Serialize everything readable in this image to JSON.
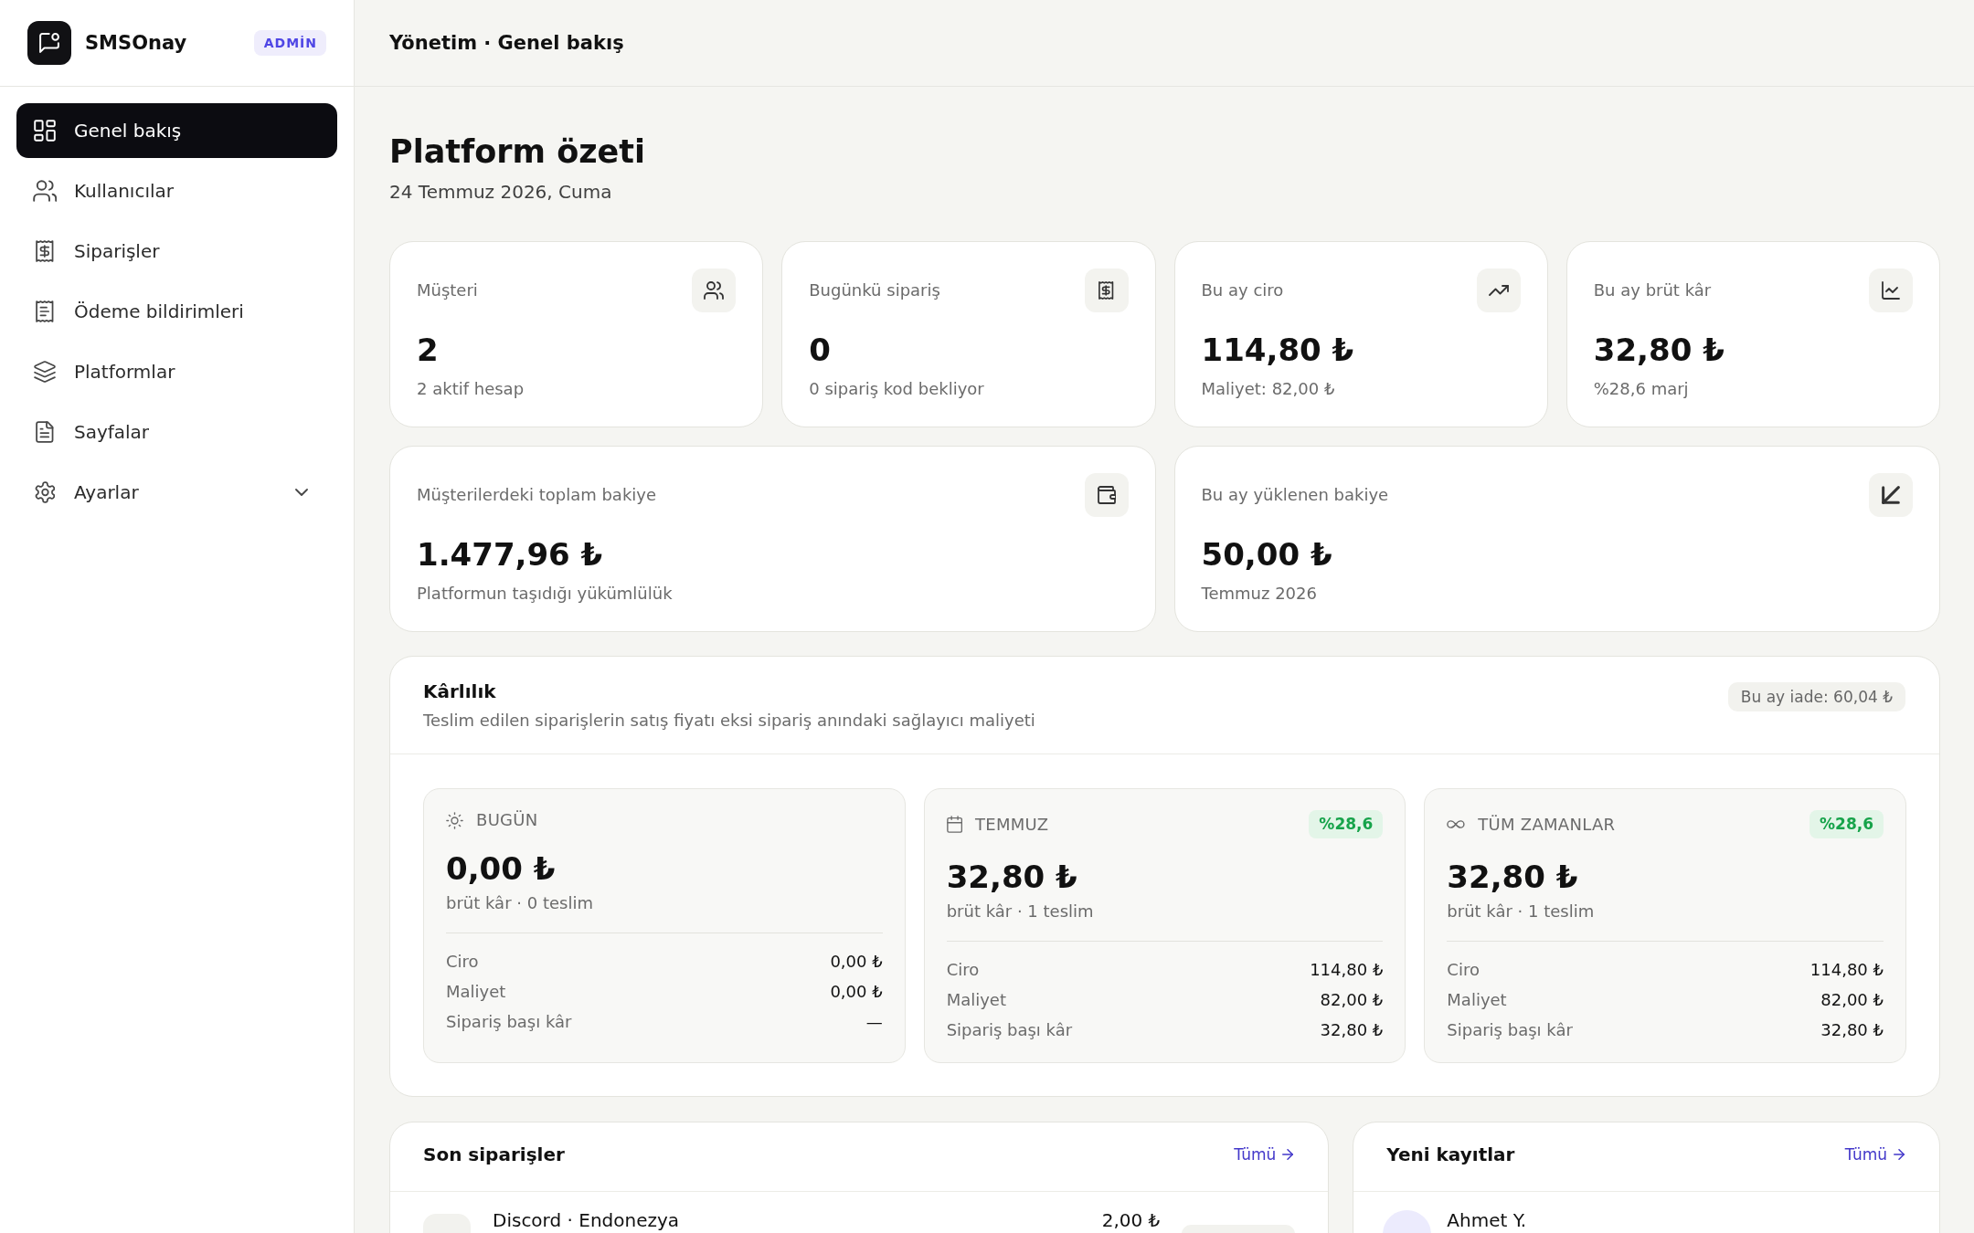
{
  "sidebar": {
    "brand": "SMSOnay",
    "role_badge": "ADMİN",
    "items": [
      {
        "label": "Genel bakış",
        "kind": "link",
        "selected": true
      },
      {
        "label": "Kullanıcılar",
        "kind": "link",
        "selected": false
      },
      {
        "label": "Siparişler",
        "kind": "link",
        "selected": false
      },
      {
        "label": "Ödeme bildirimleri",
        "kind": "link",
        "selected": false
      },
      {
        "label": "Platformlar",
        "kind": "link",
        "selected": false
      },
      {
        "label": "Sayfalar",
        "kind": "link",
        "selected": false
      },
      {
        "label": "Ayarlar",
        "kind": "group",
        "selected": false,
        "expanded": false
      }
    ]
  },
  "header": {
    "breadcrumb": "Yönetim · Genel bakış"
  },
  "page": {
    "title": "Platform özeti",
    "date": "24 Temmuz 2026, Cuma"
  },
  "stats": [
    {
      "label": "Müşteri",
      "value": "2",
      "note": "2 aktif hesap"
    },
    {
      "label": "Bugünkü sipariş",
      "value": "0",
      "note": "0 sipariş kod bekliyor"
    },
    {
      "label": "Bu ay ciro",
      "value": "114,80 ₺",
      "note": "Maliyet: 82,00 ₺"
    },
    {
      "label": "Bu ay brüt kâr",
      "value": "32,80 ₺",
      "note": "%28,6 marj"
    }
  ],
  "balances": [
    {
      "label": "Müşterilerdeki toplam bakiye",
      "value": "1.477,96 ₺",
      "note": "Platformun taşıdığı yükümlülük"
    },
    {
      "label": "Bu ay yüklenen bakiye",
      "value": "50,00 ₺",
      "note": "Temmuz 2026"
    }
  ],
  "profitability": {
    "title": "Kârlılık",
    "subtitle": "Teslim edilen siparişlerin satış fiyatı eksi sipariş anındaki sağlayıcı maliyeti",
    "refunds": "Bu ay iade: 60,04 ₺",
    "periods": [
      {
        "label": "BUGÜN",
        "value": "0,00 ₺",
        "note": "brüt kâr · 0 teslim",
        "rows": [
          {
            "label": "Ciro",
            "value": "0,00 ₺"
          },
          {
            "label": "Maliyet",
            "value": "0,00 ₺"
          },
          {
            "label": "Sipariş başı kâr",
            "value": "—"
          }
        ]
      },
      {
        "label": "TEMMUZ",
        "margin": "%28,6",
        "value": "32,80 ₺",
        "note": "brüt kâr · 1 teslim",
        "rows": [
          {
            "label": "Ciro",
            "value": "114,80 ₺"
          },
          {
            "label": "Maliyet",
            "value": "82,00 ₺"
          },
          {
            "label": "Sipariş başı kâr",
            "value": "32,80 ₺"
          }
        ]
      },
      {
        "label": "TÜM ZAMANLAR",
        "margin": "%28,6",
        "value": "32,80 ₺",
        "note": "brüt kâr · 1 teslim",
        "rows": [
          {
            "label": "Ciro",
            "value": "114,80 ₺"
          },
          {
            "label": "Maliyet",
            "value": "82,00 ₺"
          },
          {
            "label": "Sipariş başı kâr",
            "value": "32,80 ₺"
          }
        ]
      }
    ]
  },
  "recent_orders": {
    "title": "Son siparişler",
    "link": "Tümü",
    "rows": [
      {
        "title": "Discord · Endonezya",
        "amount": "2,00 ₺"
      }
    ]
  },
  "new_signups": {
    "title": "Yeni kayıtlar",
    "link": "Tümü",
    "rows": [
      {
        "name": "Ahmet Y."
      }
    ]
  }
}
